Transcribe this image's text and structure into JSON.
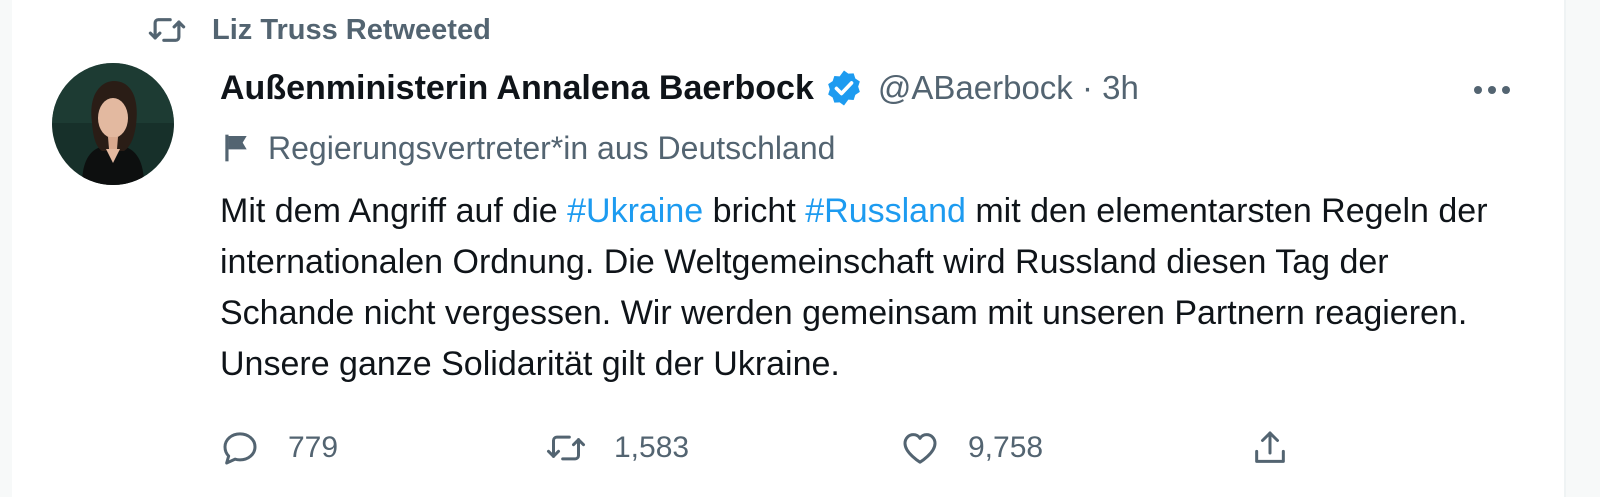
{
  "retweet": {
    "text": "Liz Truss Retweeted",
    "icon": "retweet-icon"
  },
  "author": {
    "name": "Außenministerin Annalena Baerbock",
    "verified": true,
    "handle": "@ABaerbock · 3h",
    "label": "Regierungsvertreter*in aus Deutschland"
  },
  "tweet": {
    "p1": "Mit dem Angriff auf die ",
    "tag1": "#Ukraine",
    "p2": " bricht ",
    "tag2": "#Russland",
    "p3": " mit den elementarsten Regeln der internationalen Ordnung. Die Weltgemeinschaft wird Russland diesen Tag der Schande nicht vergessen. Wir werden gemeinsam mit unseren Partnern reagieren. Unsere ganze Solidarität gilt der Ukraine."
  },
  "actions": {
    "replies": "779",
    "retweets": "1,583",
    "likes": "9,758"
  },
  "colors": {
    "accent": "#1d9bf0",
    "muted": "#536471",
    "text": "#0f1419"
  }
}
